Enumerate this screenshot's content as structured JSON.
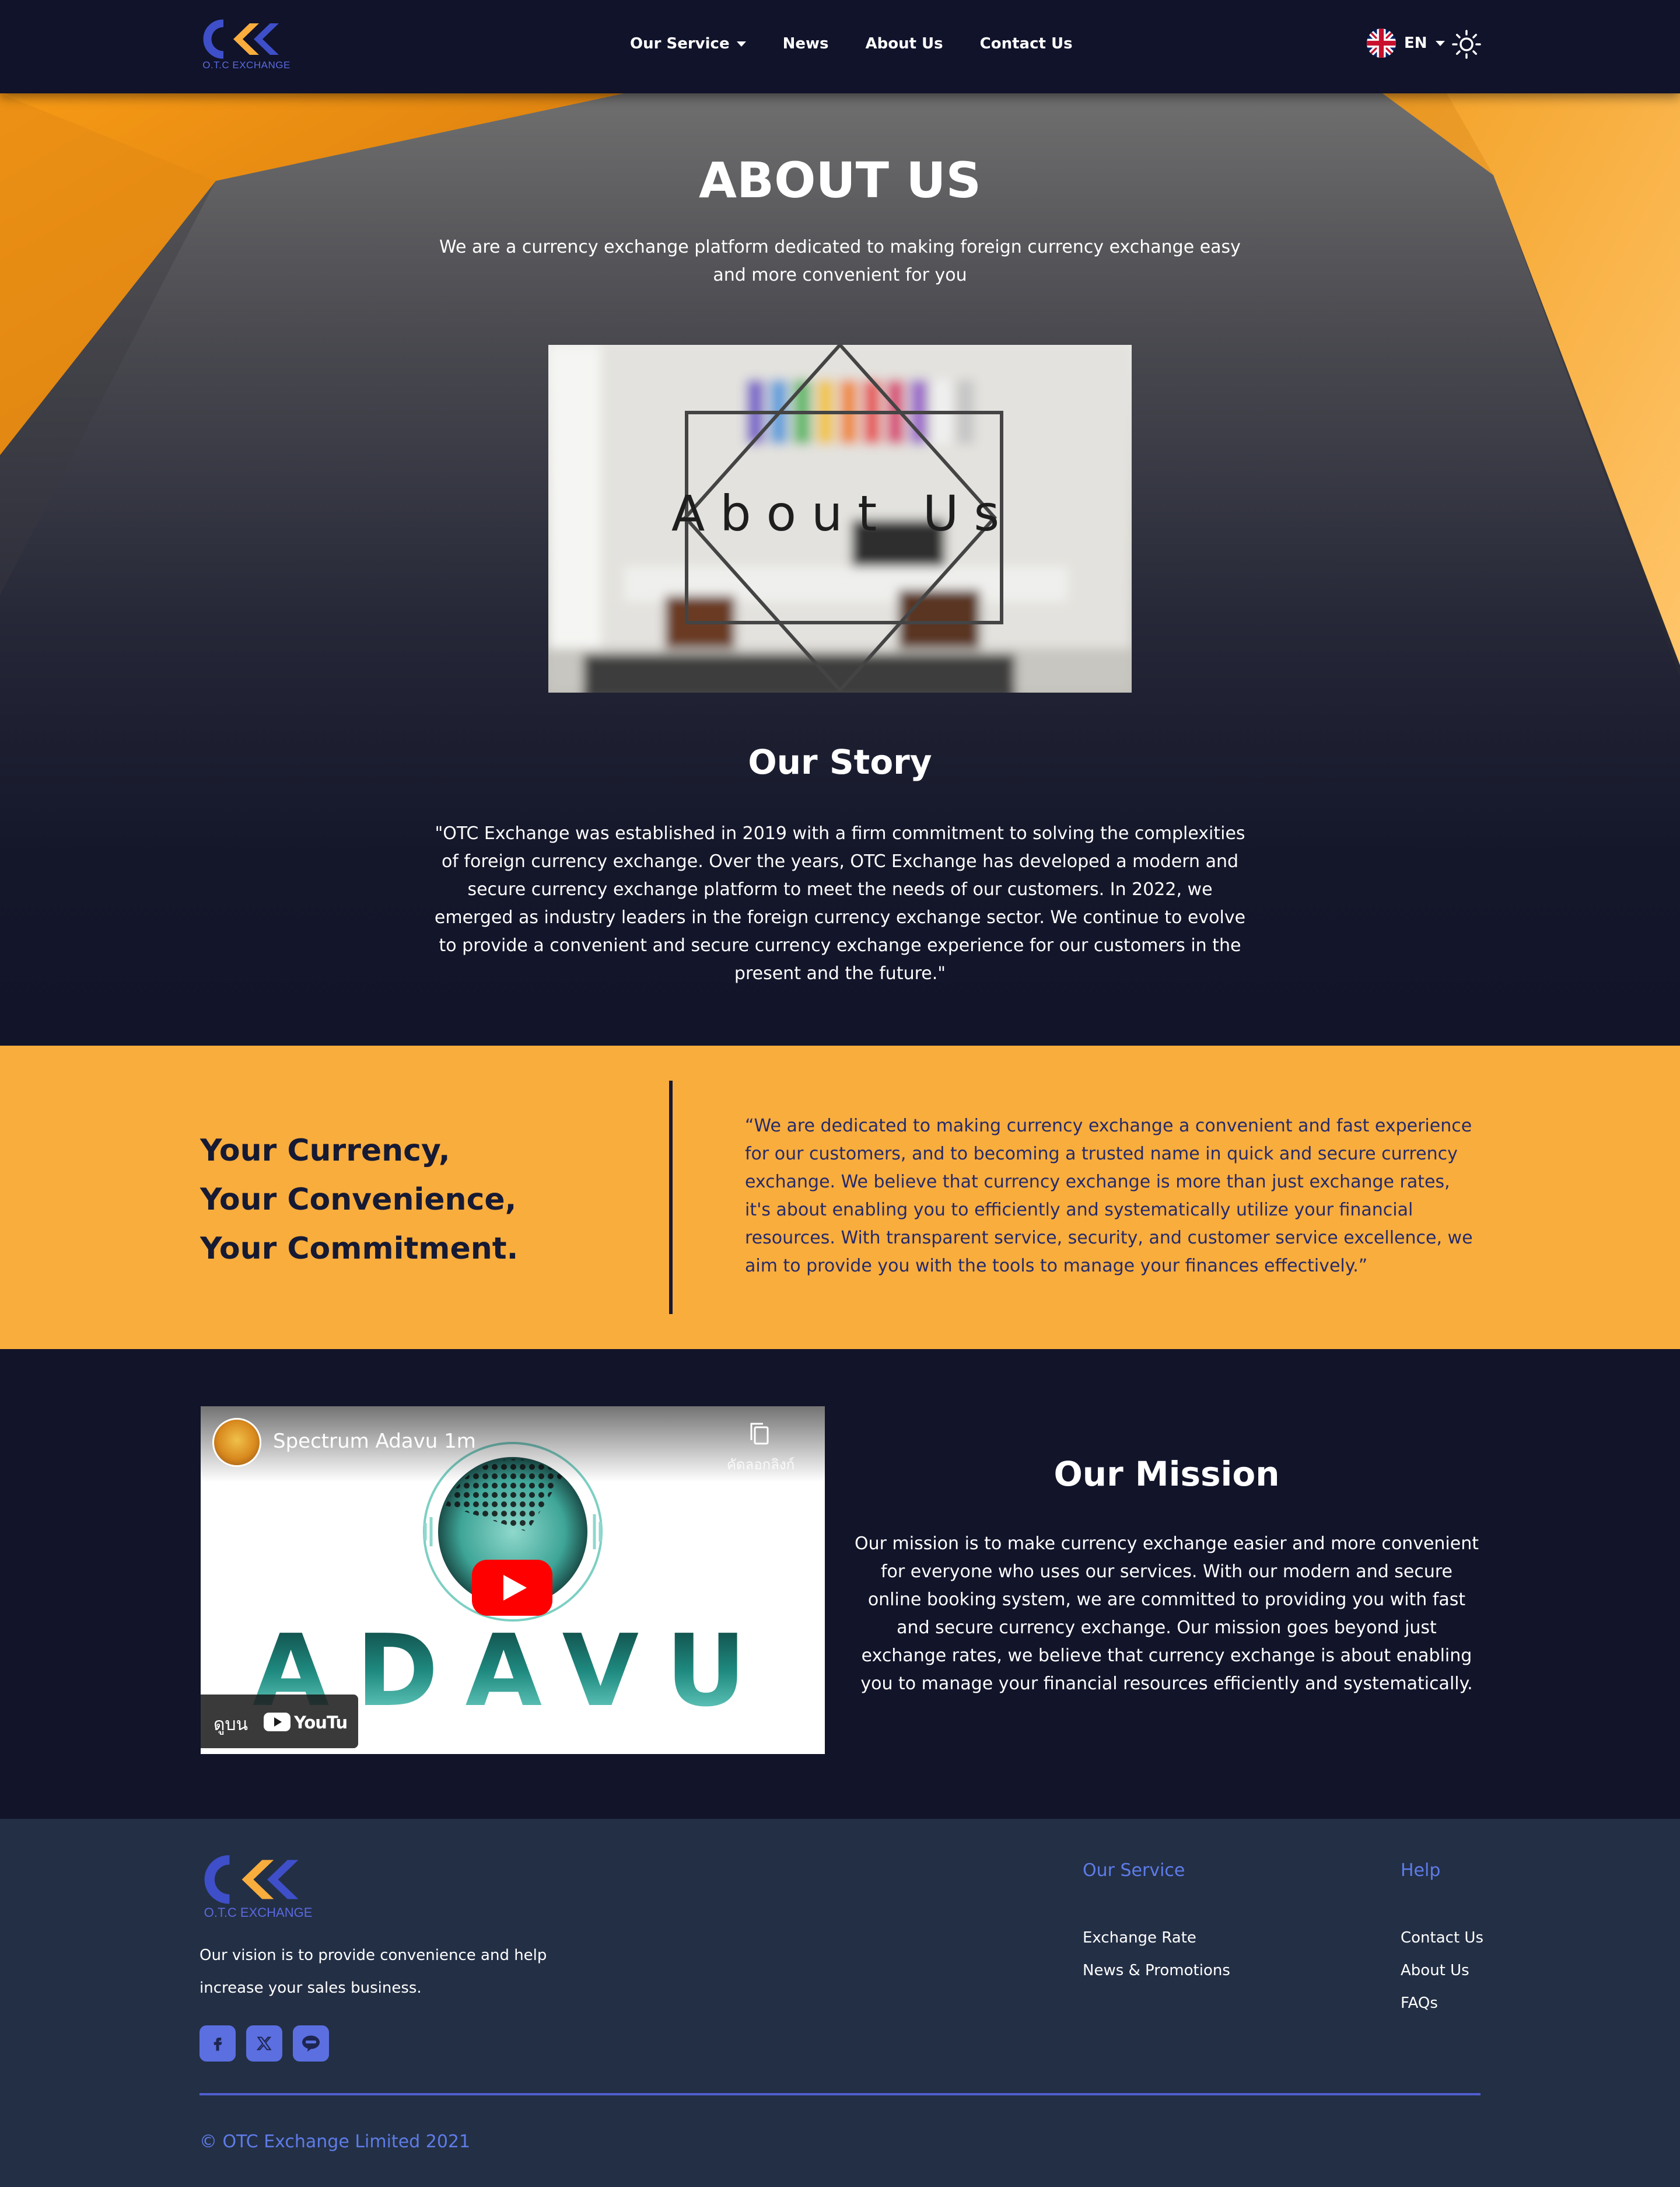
{
  "navbar": {
    "logo_sub": "O.T.C EXCHANGE",
    "links": [
      {
        "label": "Our Service",
        "dropdown": true
      },
      {
        "label": "News"
      },
      {
        "label": "About Us"
      },
      {
        "label": "Contact Us"
      }
    ],
    "language": "EN",
    "flag_icon": "uk-flag-icon",
    "theme_icon": "sun-icon"
  },
  "hero": {
    "title": "ABOUT US",
    "subtitle": "We are a currency exchange platform dedicated to making foreign currency exchange easy and more convenient for you",
    "image_caption": "About Us"
  },
  "story": {
    "title": "Our Story",
    "text": "\"OTC Exchange was established in 2019 with a firm commitment to solving the complexities of foreign currency exchange. Over the years, OTC Exchange has developed a modern and secure currency exchange platform to meet the needs of our customers. In 2022, we emerged as industry leaders in the foreign currency exchange sector. We continue to evolve to provide a convenient and secure currency exchange experience for our customers in the present and the future.\""
  },
  "band": {
    "slogan": [
      "Your Currency,",
      "Your Convenience,",
      "Your Commitment."
    ],
    "quote": "“We are dedicated to making currency exchange a convenient and fast experience for our customers, and to becoming a trusted name in quick and secure currency exchange. We believe that currency exchange is more than just exchange rates, it's about enabling you to efficiently and systematically utilize your financial resources. With transparent service, security, and customer service excellence, we aim to provide you with the tools to manage your finances effectively.”",
    "accent_color": "#f9ad3d"
  },
  "video": {
    "title": "Spectrum Adavu 1m",
    "copy_label": "คัดลอกลิงก์",
    "brand_text": "ADAVU",
    "watch_on": "ดูบน",
    "youtube_label": "YouTube"
  },
  "mission": {
    "title": "Our Mission",
    "text": "Our mission is to make currency exchange easier and more convenient for everyone who uses our services. With our modern and secure online booking system, we are committed to providing you with fast and secure currency exchange. Our mission goes beyond just exchange rates, we believe that currency exchange is about enabling you to manage your financial resources efficiently and systematically."
  },
  "footer": {
    "logo_sub": "O.T.C EXCHANGE",
    "vision": "Our vision is to provide convenience and help increase your sales business.",
    "socials": [
      "facebook-icon",
      "x-icon",
      "line-icon"
    ],
    "service": {
      "title": "Our Service",
      "items": [
        "Exchange Rate",
        "News & Promotions"
      ]
    },
    "help": {
      "title": "Help",
      "items": [
        "Contact Us",
        "About Us",
        "FAQs"
      ]
    },
    "copyright": "© OTC Exchange Limited 2021"
  }
}
